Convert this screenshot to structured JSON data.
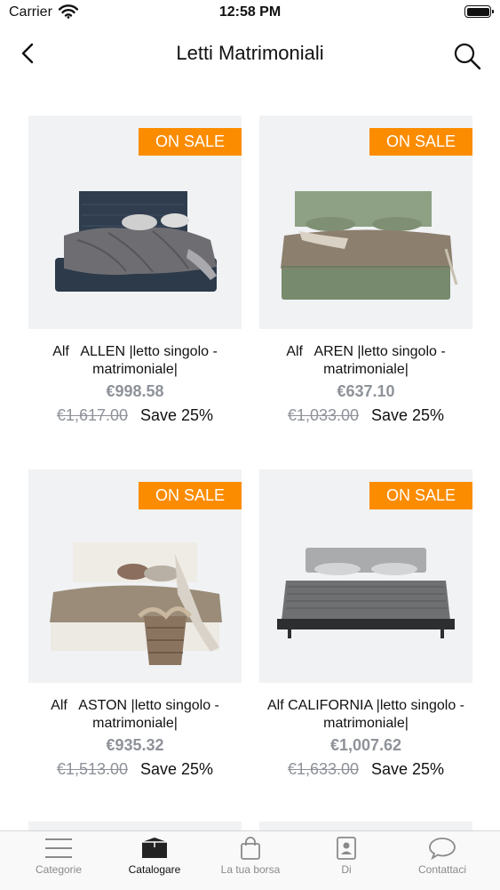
{
  "status_bar": {
    "carrier": "Carrier",
    "time": "12:58 PM"
  },
  "nav": {
    "title": "Letti Matrimoniali",
    "back_icon": "chevron-left-icon",
    "search_icon": "search-icon"
  },
  "products": [
    {
      "name": "Alf   ALLEN |letto singolo -\nmatrimoniale|",
      "price": "€998.58",
      "old_price": "€1,617.00",
      "save": "Save 25%",
      "badge": "ON SALE",
      "image": "dark-blue-quilted-bed"
    },
    {
      "name": "Alf   AREN |letto singolo -\nmatrimoniale|",
      "price": "€637.10",
      "old_price": "€1,033.00",
      "save": "Save 25%",
      "badge": "ON SALE",
      "image": "green-upholstered-bed"
    },
    {
      "name": "Alf   ASTON |letto singolo -\nmatrimoniale|",
      "price": "€935.32",
      "old_price": "€1,513.00",
      "save": "Save 25%",
      "badge": "ON SALE",
      "image": "white-bed-with-basket"
    },
    {
      "name": "Alf CALIFORNIA |letto singolo -\nmatrimoniale|",
      "price": "€1,007.62",
      "old_price": "€1,633.00",
      "save": "Save 25%",
      "badge": "ON SALE",
      "image": "grey-bed-black-frame"
    }
  ],
  "tabs": [
    {
      "label": "Categorie",
      "icon": "menu-lines-icon",
      "active": false
    },
    {
      "label": "Catalogare",
      "icon": "box-icon",
      "active": true
    },
    {
      "label": "La tua borsa",
      "icon": "shopping-bag-icon",
      "active": false
    },
    {
      "label": "Di",
      "icon": "contact-card-icon",
      "active": false
    },
    {
      "label": "Contattaci",
      "icon": "chat-bubble-icon",
      "active": false
    }
  ],
  "colors": {
    "badge": "#fb8c00",
    "image_bg": "#f0f2f4",
    "price_grey": "#8e9299"
  }
}
